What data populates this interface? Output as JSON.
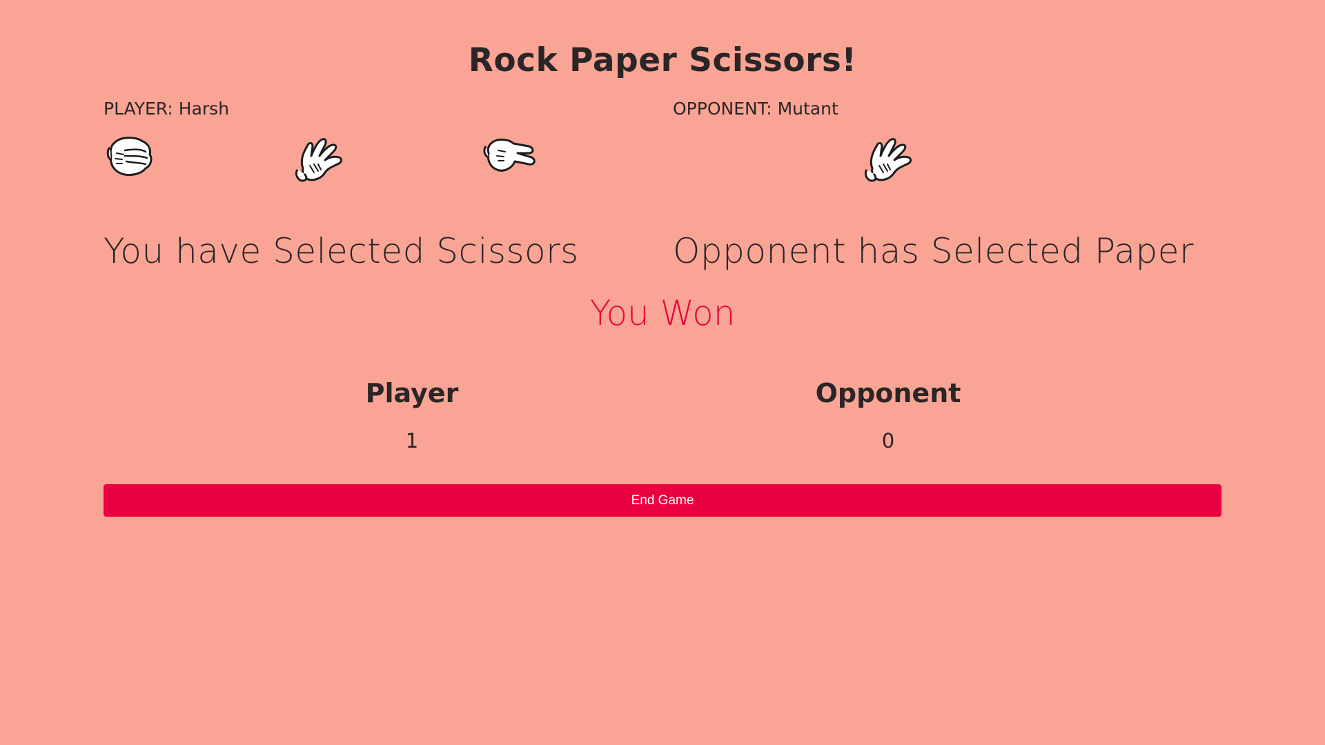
{
  "header": {
    "title": "Rock Paper Scissors!"
  },
  "player": {
    "label": "PLAYER: Harsh",
    "selection_text": "You have Selected Scissors",
    "choices": [
      {
        "name": "rock-icon"
      },
      {
        "name": "paper-icon"
      },
      {
        "name": "scissors-icon"
      }
    ]
  },
  "opponent": {
    "label": "OPPONENT: Mutant",
    "selection_text": "Opponent has Selected Paper",
    "choice": {
      "name": "paper-icon"
    }
  },
  "result": {
    "text": "You Won",
    "color": "#e8083e"
  },
  "scoreboard": {
    "player_heading": "Player",
    "player_score": "1",
    "opponent_heading": "Opponent",
    "opponent_score": "0"
  },
  "actions": {
    "end_game_label": "End Game",
    "button_color": "#ea0040"
  },
  "theme": {
    "background": "#f9a495",
    "text": "#2a2526"
  }
}
